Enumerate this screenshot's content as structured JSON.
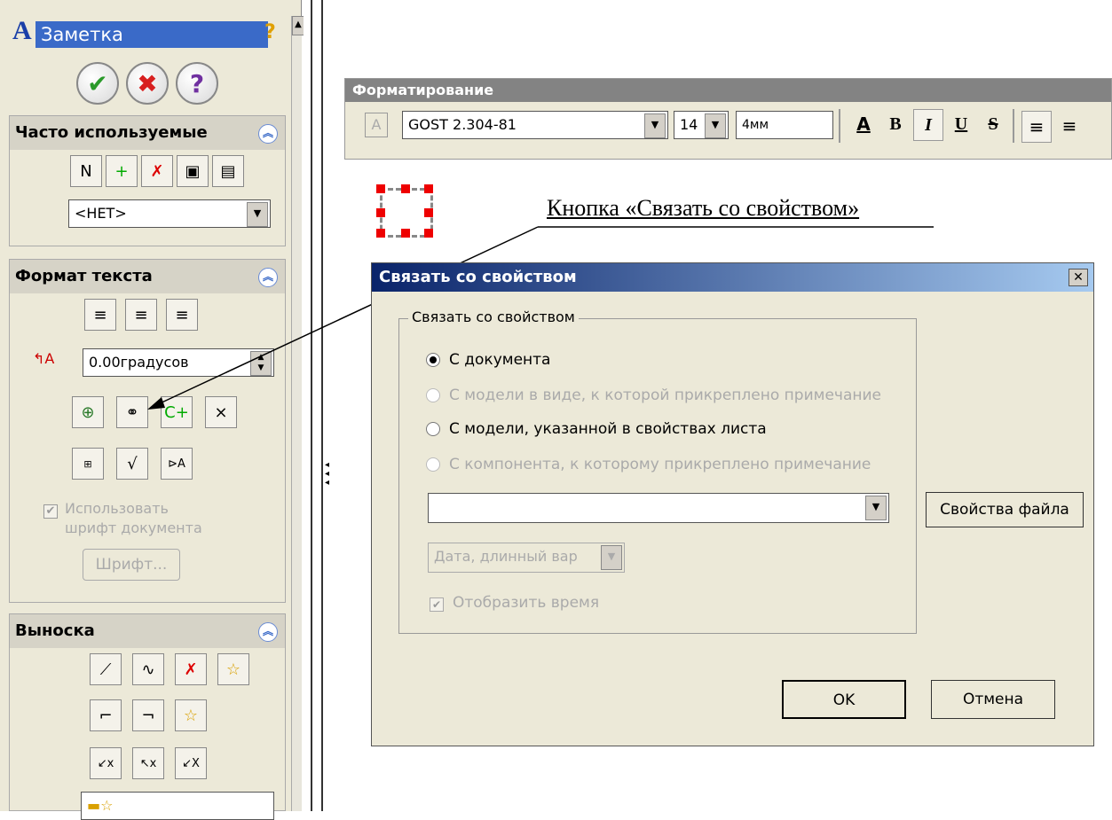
{
  "pm": {
    "title": "Заметка",
    "help_icon": "question-mark",
    "actions": {
      "ok_icon": "check",
      "cancel_icon": "cross",
      "help_icon": "question"
    },
    "frequent": {
      "header": "Часто используемые",
      "tools": [
        "new-favorite-icon",
        "add-favorite-icon",
        "delete-favorite-icon",
        "save-favorite-icon",
        "load-favorite-icon"
      ],
      "combo_value": "<НЕТ>"
    },
    "text_format": {
      "header": "Формат текста",
      "angle_value": "0.00градусов",
      "checkbox_label": "Использовать шрифт документа",
      "font_button": "Шрифт..."
    },
    "leader": {
      "header": "Выноска"
    }
  },
  "toolbar": {
    "title": "Форматирование",
    "font": "GOST 2.304-81",
    "size": "14",
    "height": "4мм"
  },
  "annotation": {
    "label": "Кнопка «Связать  со свойством»"
  },
  "dialog": {
    "title": "Связать со свойством",
    "group_label": "Связать со свойством",
    "options": [
      {
        "label": "С документа",
        "selected": true,
        "enabled": true
      },
      {
        "label": "С модели в виде, к которой прикреплено примечание",
        "selected": false,
        "enabled": false
      },
      {
        "label": "С модели, указанной в свойствах листа",
        "selected": false,
        "enabled": true
      },
      {
        "label": "С компонента, к которому прикреплено примечание",
        "selected": false,
        "enabled": false
      }
    ],
    "property_value": "",
    "date_format": "Дата, длинный вар",
    "show_time_label": "Отобразить время",
    "file_props_button": "Свойства файла",
    "ok_button": "OK",
    "cancel_button": "Отмена"
  }
}
